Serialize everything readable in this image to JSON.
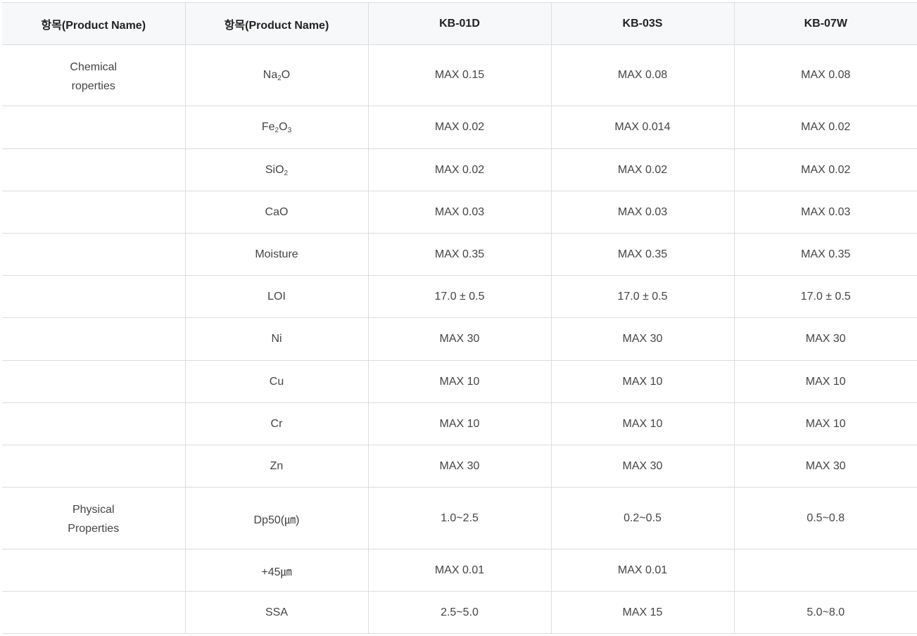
{
  "headers": [
    "항목(Product Name)",
    "항목(Product Name)",
    "KB-01D",
    "KB-03S",
    "KB-07W"
  ],
  "rows": [
    {
      "group": "Chemical\nroperties",
      "item": "Na",
      "sub1": "2",
      "mid": "O",
      "sub2": "",
      "tail": "",
      "v1": "MAX 0.15",
      "v2": "MAX 0.08",
      "v3": "MAX 0.08",
      "h": 87
    },
    {
      "group": "",
      "item": "Fe",
      "sub1": "2",
      "mid": "O",
      "sub2": "3",
      "tail": "",
      "v1": "MAX 0.02",
      "v2": "MAX 0.014",
      "v3": "MAX 0.02",
      "h": 61
    },
    {
      "group": "",
      "item": "SiO",
      "sub1": "2",
      "mid": "",
      "sub2": "",
      "tail": "",
      "v1": "MAX 0.02",
      "v2": "MAX 0.02",
      "v3": "MAX 0.02",
      "h": 60
    },
    {
      "group": "",
      "item": "CaO",
      "sub1": "",
      "mid": "",
      "sub2": "",
      "tail": "",
      "v1": "MAX 0.03",
      "v2": "MAX 0.03",
      "v3": "MAX 0.03",
      "h": 60
    },
    {
      "group": "",
      "item": "Moisture",
      "sub1": "",
      "mid": "",
      "sub2": "",
      "tail": "",
      "v1": "MAX 0.35",
      "v2": "MAX 0.35",
      "v3": "MAX 0.35",
      "h": 60
    },
    {
      "group": "",
      "item": "LOI",
      "sub1": "",
      "mid": "",
      "sub2": "",
      "tail": "",
      "v1": "17.0 ± 0.5",
      "v2": "17.0 ± 0.5",
      "v3": "17.0 ± 0.5",
      "h": 60
    },
    {
      "group": "",
      "item": "Ni",
      "sub1": "",
      "mid": "",
      "sub2": "",
      "tail": "",
      "v1": "MAX 30",
      "v2": "MAX 30",
      "v3": "MAX 30",
      "h": 61
    },
    {
      "group": "",
      "item": "Cu",
      "sub1": "",
      "mid": "",
      "sub2": "",
      "tail": "",
      "v1": "MAX 10",
      "v2": "MAX 10",
      "v3": "MAX 10",
      "h": 60
    },
    {
      "group": "",
      "item": "Cr",
      "sub1": "",
      "mid": "",
      "sub2": "",
      "tail": "",
      "v1": "MAX 10",
      "v2": "MAX 10",
      "v3": "MAX 10",
      "h": 60
    },
    {
      "group": "",
      "item": "Zn",
      "sub1": "",
      "mid": "",
      "sub2": "",
      "tail": "",
      "v1": "MAX 30",
      "v2": "MAX 30",
      "v3": "MAX 30",
      "h": 60
    },
    {
      "group": "Physical\nProperties",
      "item": "Dp50(㎛)",
      "sub1": "",
      "mid": "",
      "sub2": "",
      "tail": "",
      "v1": "1.0~2.5",
      "v2": "0.2~0.5",
      "v3": "0.5~0.8",
      "h": 88
    },
    {
      "group": "",
      "item": "+45㎛",
      "sub1": "",
      "mid": "",
      "sub2": "",
      "tail": "",
      "v1": "MAX 0.01",
      "v2": "MAX 0.01",
      "v3": "",
      "h": 60
    },
    {
      "group": "",
      "item": "SSA",
      "sub1": "",
      "mid": "",
      "sub2": "",
      "tail": "",
      "v1": "2.5~5.0",
      "v2": "MAX 15",
      "v3": "5.0~8.0",
      "h": 60
    }
  ]
}
